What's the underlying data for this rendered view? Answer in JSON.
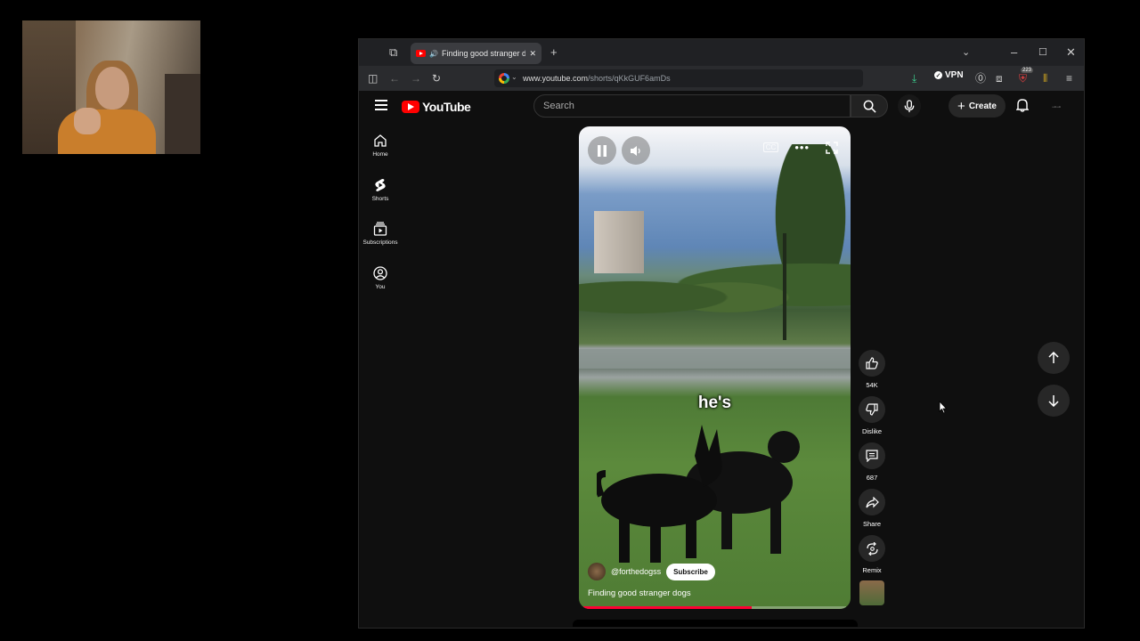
{
  "browser": {
    "tab_title": "Finding good stranger dogs",
    "url_domain": "www.youtube.com",
    "url_path": "/shorts/qKkGUF6amDs",
    "vpn_label": "VPN",
    "badge_count": "223"
  },
  "youtube": {
    "logo_text": "YouTube",
    "search_placeholder": "Search",
    "create_label": "Create",
    "sidebar": [
      {
        "label": "Home"
      },
      {
        "label": "Shorts"
      },
      {
        "label": "Subscriptions"
      },
      {
        "label": "You"
      }
    ]
  },
  "short": {
    "caption": "he's",
    "channel": "@forthedogss",
    "subscribe_label": "Subscribe",
    "title": "Finding good stranger dogs",
    "progress": 0.64,
    "likes": "54K",
    "dislike_label": "Dislike",
    "comments": "687",
    "share_label": "Share",
    "remix_label": "Remix"
  },
  "colors": {
    "accent": "#ff0000",
    "progress": "#ff0033",
    "background": "#0f0f0f"
  }
}
